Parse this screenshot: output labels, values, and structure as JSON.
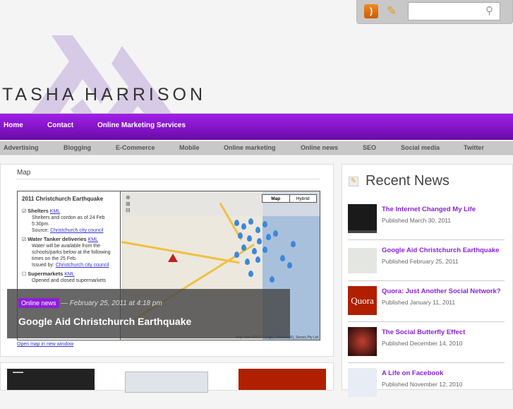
{
  "header": {
    "brand": "TASHA HARRISON",
    "search_placeholder": ""
  },
  "icons": {
    "rss": "rss-icon",
    "contact": "contact-pencil-icon",
    "search": "search-icon"
  },
  "nav": [
    "Home",
    "Contact",
    "Online Marketing Services"
  ],
  "categories": [
    "Advertising",
    "Blogging",
    "E-Commerce",
    "Mobile",
    "Online marketing",
    "Online news",
    "SEO",
    "Social media",
    "Twitter"
  ],
  "featured": {
    "map_heading": "Map",
    "map_title": "2011 Christchurch Earthquake",
    "layers": [
      {
        "name": "Shelters",
        "kml": "KML",
        "desc": "Shelters and cordon as of 24 Feb 5:30pm.",
        "source_label": "Source:",
        "source": "Christchurch city council"
      },
      {
        "name": "Water Tanker deliveries",
        "kml": "KML",
        "desc": "Water will be available from the schools/parks below at the following times on the 25 Feb.",
        "source_label": "Issued by:",
        "source": "Christchurch city council"
      },
      {
        "name": "Supermarkets",
        "kml": "KML",
        "desc": "Opened and closed supermarkets"
      }
    ],
    "map_btn": "Map",
    "hybrid_btn": "Hybrid",
    "attribution": "Map data ©2011 Google, Whereis(R), Sensis Pty Ltd",
    "open_map": "Open map in new window",
    "category": "Online news",
    "date": "— February 25, 2011 at 4:18 pm",
    "title": "Google Aid Christchurch Earthquake"
  },
  "sidebar": {
    "heading": "Recent News",
    "items": [
      {
        "title": "The Internet Changed My Life",
        "date": "Published March 30, 2011"
      },
      {
        "title": "Google Aid Christchurch Earthquake",
        "date": "Published February 25, 2011"
      },
      {
        "title": "Quora: Just Another Social Network?",
        "date": "Published January 11, 2011",
        "thumb_text": "Quora"
      },
      {
        "title": "The Social Butterfly Effect",
        "date": "Published December 14, 2010"
      },
      {
        "title": "A Life on Facebook",
        "date": "Published November 12, 2010"
      }
    ]
  },
  "colors": {
    "purple": "#8a22d8",
    "nav_top": "#a020e8",
    "nav_bottom": "#6a0aa8"
  }
}
